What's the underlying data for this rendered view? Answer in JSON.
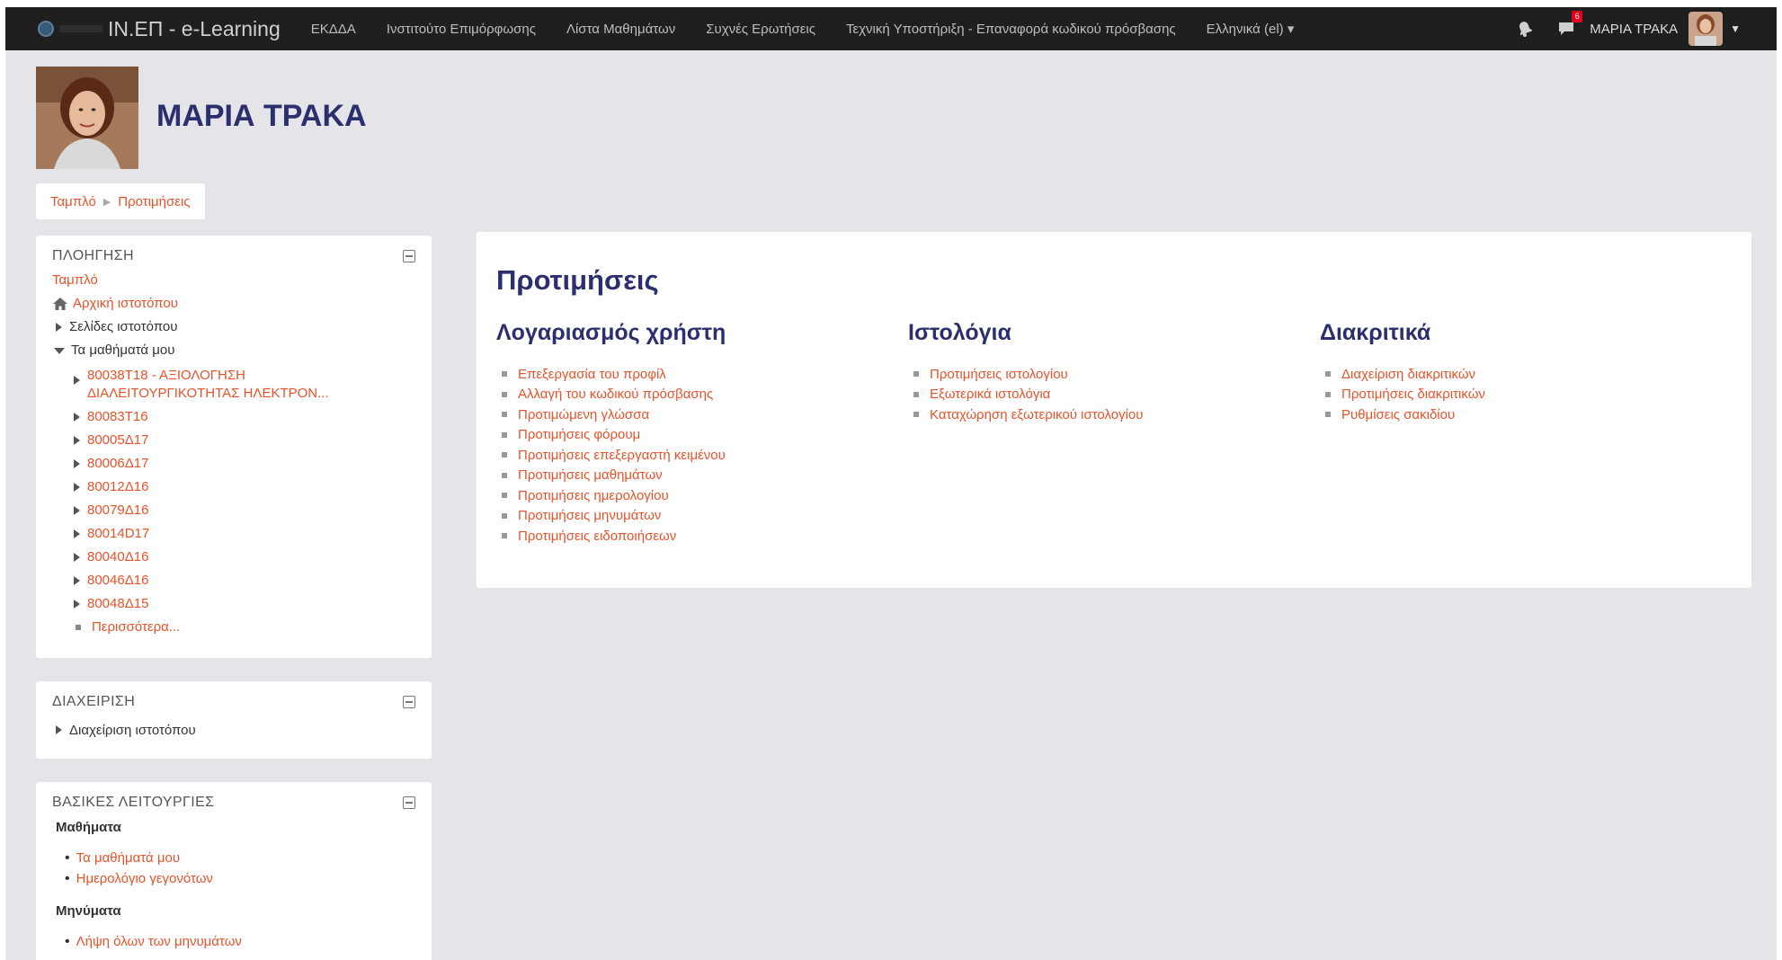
{
  "navbar": {
    "title": "IN.ΕΠ - e-Learning",
    "links": [
      "ΕΚΔΔΑ",
      "Ινστιτούτο Επιμόρφωσης",
      "Λίστα Μαθημάτων",
      "Συχνές Ερωτήσεις",
      "Τεχνική Υποστήριξη - Επαναφορά κωδικού πρόσβασης",
      "Ελληνικά (el) ▾"
    ],
    "message_count": "6",
    "user_name": "ΜΑΡΙΑ ΤΡΑΚΑ"
  },
  "header": {
    "name": "ΜΑΡΙΑ ΤΡΑΚΑ"
  },
  "breadcrumb": [
    "Ταμπλό",
    "Προτιμήσεις"
  ],
  "nav_block": {
    "title": "ΠΛΟΗΓΗΣΗ",
    "dashboard": "Ταμπλό",
    "site_home": "Αρχική ιστοτόπου",
    "site_pages": "Σελίδες ιστοτόπου",
    "my_courses": "Τα μαθήματά μου",
    "courses": [
      "80038Τ18 - ΑΞΙΟΛΟΓΗΣΗ ΔΙΑΛΕΙΤΟΥΡΓΙΚΟΤΗΤΑΣ ΗΛΕΚΤΡΟΝ...",
      "80083Τ16",
      "80005Δ17",
      "80006Δ17",
      "80012Δ16",
      "80079Δ16",
      "80014D17",
      "80040Δ16",
      "80046Δ16",
      "80048Δ15"
    ],
    "more": "Περισσότερα..."
  },
  "admin_block": {
    "title": "ΔΙΑΧΕΙΡΙΣΗ",
    "item": "Διαχείριση ιστοτόπου"
  },
  "basic_block": {
    "title": "ΒΑΣΙΚΕΣ ΛΕΙΤΟΥΡΓΙΕΣ",
    "courses_heading": "Μαθήματα",
    "courses_links": [
      "Τα μαθήματά μου",
      "Ημερολόγιο γεγονότων"
    ],
    "messages_heading": "Μηνύματα",
    "messages_links": [
      "Λήψη όλων των μηνυμάτων"
    ]
  },
  "main": {
    "title": "Προτιμήσεις",
    "columns": [
      {
        "title": "Λογαριασμός χρήστη",
        "links": [
          "Επεξεργασία του προφίλ",
          "Αλλαγή του κωδικού πρόσβασης",
          "Προτιμώμενη γλώσσα",
          "Προτιμήσεις φόρουμ",
          "Προτιμήσεις επεξεργαστή κειμένου",
          "Προτιμήσεις μαθημάτων",
          "Προτιμήσεις ημερολογίου",
          "Προτιμήσεις μηνυμάτων",
          "Προτιμήσεις ειδοποιήσεων"
        ]
      },
      {
        "title": "Ιστολόγια",
        "links": [
          "Προτιμήσεις ιστολογίου",
          "Εξωτερικά ιστολόγια",
          "Καταχώρηση εξωτερικού ιστολογίου"
        ]
      },
      {
        "title": "Διακριτικά",
        "links": [
          "Διαχείριση διακριτικών",
          "Προτιμήσεις διακριτικών",
          "Ρυθμίσεις σακιδίου"
        ]
      }
    ]
  }
}
